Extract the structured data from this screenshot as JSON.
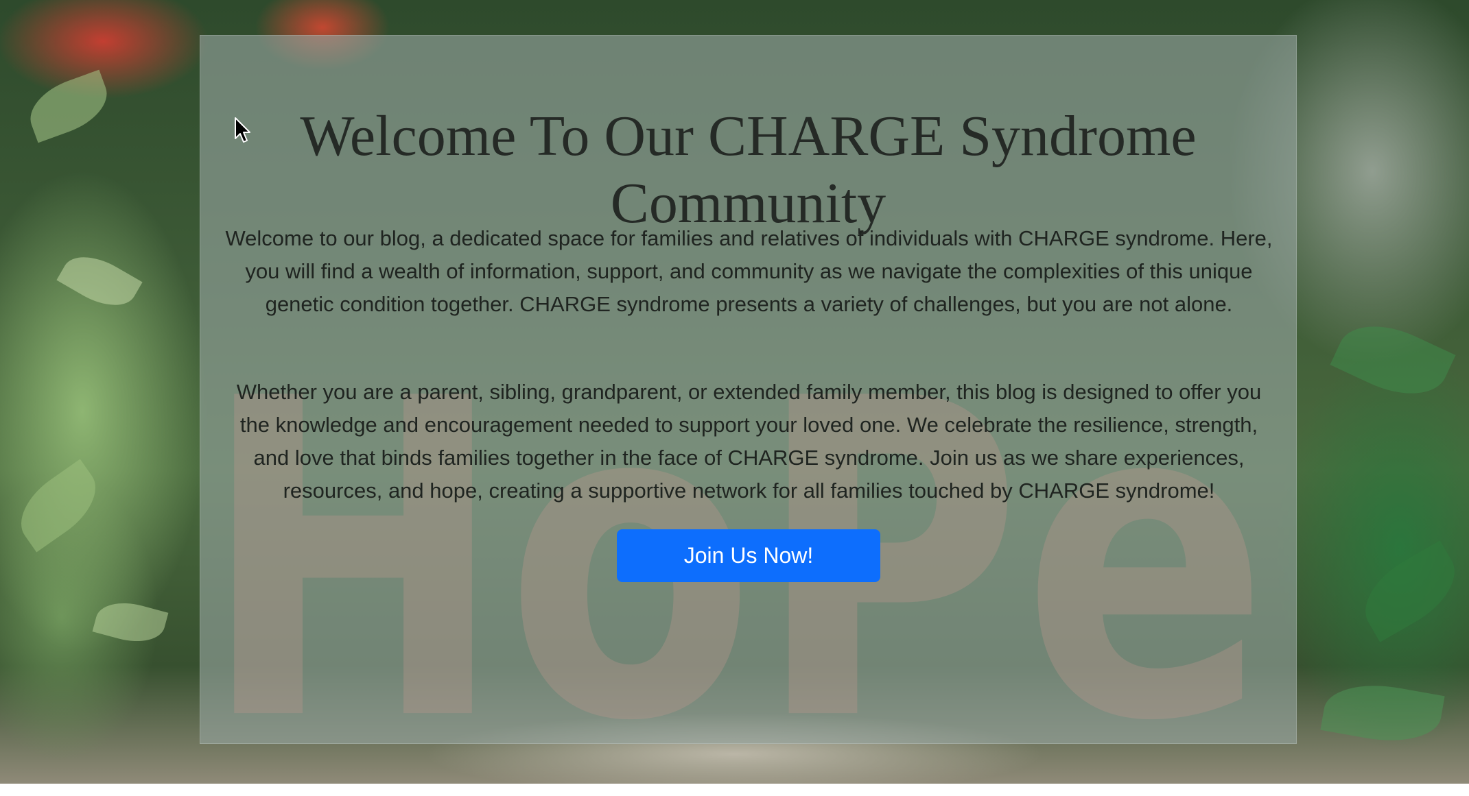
{
  "hero": {
    "title": "Welcome To Our CHARGE Syndrome Community",
    "paragraphs": [
      "Welcome to our blog, a dedicated space for families and relatives of individuals with CHARGE syndrome. Here, you will find a wealth of information, support, and community as we navigate the complexities of this unique genetic condition together. CHARGE syndrome presents a variety of challenges, but you are not alone.",
      "Whether you are a parent, sibling, grandparent, or extended family member, this blog is designed to offer you the knowledge and encouragement needed to support your loved one. We celebrate the resilience, strength, and love that binds families together in the face of CHARGE syndrome. Join us as we share experiences, resources, and hope, creating a supportive network for all families touched by CHARGE syndrome!"
    ],
    "cta_label": "Join Us Now!",
    "background_letters": "HoPe"
  },
  "colors": {
    "cta_background": "#0d6efd",
    "cta_text": "#ffffff",
    "heading_text": "#252a26",
    "body_text": "#1f2420",
    "card_overlay": "rgba(150,165,160,0.62)"
  },
  "icons": {
    "cursor": "mouse-pointer-icon"
  }
}
